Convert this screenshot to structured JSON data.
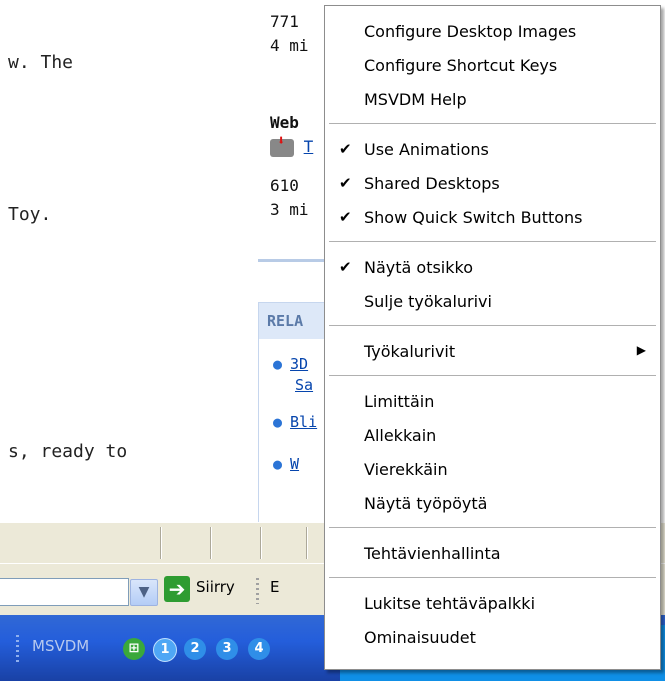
{
  "background_page": {
    "left_text": [
      "w. The",
      "Toy.",
      "s, ready to"
    ],
    "mid_column": {
      "line1": "771",
      "line2": "4 mi",
      "heading": "Web",
      "link": "T",
      "line3": "610",
      "line4": "3 mi"
    },
    "related_box": {
      "header": "RELA",
      "items": [
        "3D",
        "Sa",
        "Bli",
        "W"
      ]
    }
  },
  "address_bar": {
    "go_label": "Siirry",
    "next_text": "E"
  },
  "taskbar": {
    "toolbar_label": "MSVDM",
    "desktop_buttons": [
      "1",
      "2",
      "3",
      "4"
    ]
  },
  "context_menu": {
    "groups": [
      {
        "items": [
          {
            "label": "Configure Desktop Images",
            "checked": false
          },
          {
            "label": "Configure Shortcut Keys",
            "checked": false
          },
          {
            "label": "MSVDM Help",
            "checked": false
          }
        ]
      },
      {
        "items": [
          {
            "label": "Use Animations",
            "checked": true
          },
          {
            "label": "Shared Desktops",
            "checked": true
          },
          {
            "label": "Show Quick Switch Buttons",
            "checked": true
          }
        ]
      },
      {
        "items": [
          {
            "label": "Näytä otsikko",
            "checked": true
          },
          {
            "label": "Sulje työkalurivi",
            "checked": false
          }
        ]
      },
      {
        "items": [
          {
            "label": "Työkalurivit",
            "checked": false,
            "submenu": true
          }
        ]
      },
      {
        "items": [
          {
            "label": "Limittäin",
            "checked": false
          },
          {
            "label": "Allekkain",
            "checked": false
          },
          {
            "label": "Vierekkäin",
            "checked": false
          },
          {
            "label": "Näytä työpöytä",
            "checked": false
          }
        ]
      },
      {
        "items": [
          {
            "label": "Tehtävienhallinta",
            "checked": false
          }
        ]
      },
      {
        "items": [
          {
            "label": "Lukitse tehtäväpalkki",
            "checked": false
          },
          {
            "label": "Ominaisuudet",
            "checked": false
          }
        ]
      }
    ],
    "check_glyph": "✔",
    "submenu_glyph": "▶"
  }
}
